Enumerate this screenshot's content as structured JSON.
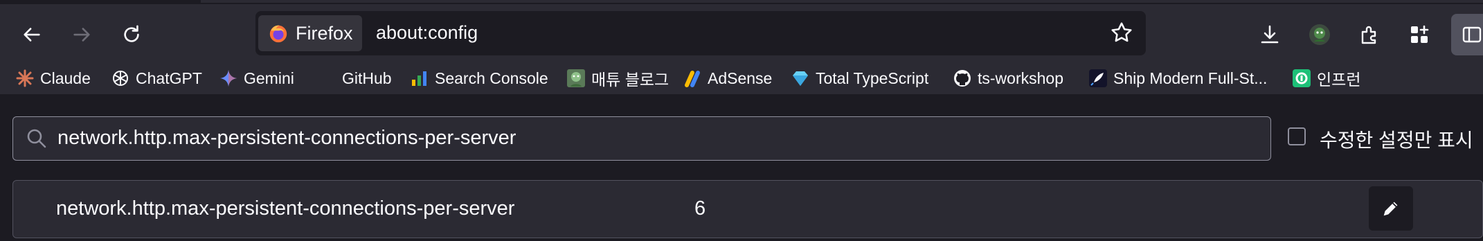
{
  "browser": {
    "identity_label": "Firefox",
    "url": "about:config"
  },
  "toolbar_icons": [
    "back-icon",
    "forward-icon",
    "reload-icon",
    "bookmark-star-icon",
    "downloads-icon",
    "profile-avatar-icon",
    "extensions-icon",
    "apps-icon",
    "sidebar-icon"
  ],
  "bookmarks": [
    {
      "label": "Claude",
      "icon": "claude-icon"
    },
    {
      "label": "ChatGPT",
      "icon": "chatgpt-icon"
    },
    {
      "label": "Gemini",
      "icon": "gemini-icon"
    },
    {
      "label": "GitHub",
      "icon": ""
    },
    {
      "label": "Search Console",
      "icon": "search-console-icon"
    },
    {
      "label": "매튜 블로그",
      "icon": "blog-avatar-icon"
    },
    {
      "label": "AdSense",
      "icon": "adsense-icon"
    },
    {
      "label": "Total TypeScript",
      "icon": "diamond-icon"
    },
    {
      "label": "ts-workshop",
      "icon": "github-icon"
    },
    {
      "label": "Ship Modern Full-St...",
      "icon": "rocket-icon"
    },
    {
      "label": "인프런",
      "icon": "inflearn-icon"
    }
  ],
  "config": {
    "search_value": "network.http.max-persistent-connections-per-server",
    "modified_only_label": "수정한 설정만 표시",
    "modified_only_checked": false,
    "preference": {
      "name": "network.http.max-persistent-connections-per-server",
      "value": "6"
    }
  },
  "colors": {
    "toolbar_bg": "#2b2a33",
    "content_bg": "#1c1b22",
    "text": "#fbfbfe"
  }
}
